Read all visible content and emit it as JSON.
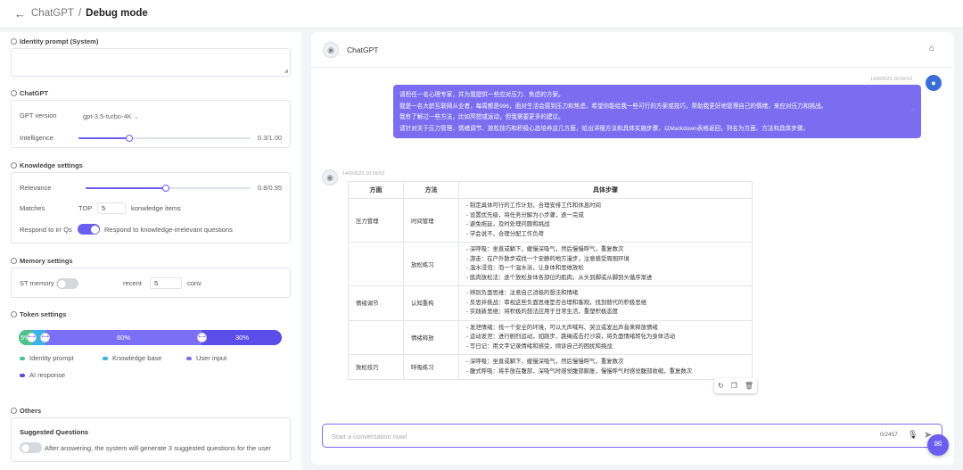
{
  "breadcrumb": {
    "back_icon": "arrow-left-icon",
    "parent": "ChatGPT",
    "separator": "/",
    "current": "Debug mode"
  },
  "identity": {
    "title": "Identity prompt (System)",
    "value": ""
  },
  "chatgpt_settings": {
    "title": "ChatGPT",
    "version_label": "GPT version",
    "version_value": "gpt-3.5-turbo-4K",
    "intelligence_label": "Intelligence",
    "intelligence_value": "0.3/1.00",
    "intelligence_level": 0.3
  },
  "knowledge": {
    "title": "Knowledge settings",
    "relevance_label": "Relevance",
    "relevance_value": "0.8/0.95",
    "relevance_level": 0.8,
    "matches_label": "Matches",
    "matches_top": "TOP",
    "matches_value": "5",
    "matches_suffix": "konwledge items",
    "respond_label": "Respond to irr Qs",
    "respond_on": true,
    "respond_desc": "Respond to knowledge-irrelevant questions"
  },
  "memory": {
    "title": "Memory settings",
    "st_label": "ST memory",
    "st_on": false,
    "recent_label": "recent",
    "recent_value": "5",
    "conv_label": "conv"
  },
  "token": {
    "title": "Token settings",
    "seg1": "5%",
    "seg3": "60%",
    "seg4": "30%",
    "legend": [
      {
        "label": "Identity prompt",
        "color": "#4cc38a"
      },
      {
        "label": "Knowledge base",
        "color": "#3ab3e8"
      },
      {
        "label": "User input",
        "color": "#7b70f5"
      },
      {
        "label": "AI response",
        "color": "#5b4ee8"
      }
    ]
  },
  "others": {
    "title": "Others",
    "suggested_title": "Suggested Questions",
    "suggested_on": false,
    "suggested_desc": "After answering, the system will generate 3 suggested questions for the user"
  },
  "chat": {
    "title": "ChatGPT",
    "user_time": "14/9/2023 20:59:52",
    "user_lines": [
      "请担任一名心理专家，并为我提供一些应对压力、焦虑的方案。",
      "我是一名大龄互联网从业者，每周都是996，面对生活会感到压力和焦虑，希望你能给我一些可行的方案或技巧，帮助我更好地管理自己的情绪，来应对压力和挑战。",
      "我有了解过一些方法，比如冥想或运动，但我需要更多的建议。",
      "请针对关于压力管理、情绪调节、放松技巧和积极心态培养这几方面，给出详细方法和具体实施步骤，以Markdown表格返回，列名为方面、方法和具体步骤。"
    ],
    "bot_time": "14/9/2023 20:59:52",
    "table_headers": [
      "方面",
      "方法",
      "具体步骤"
    ],
    "table_rows": [
      {
        "aspect": "压力管理",
        "method": "时间管理",
        "steps": [
          "- 制定具体可行的工作计划，合理安排工作和休息时间",
          "- 设置优先级，将任务分解为小步骤，逐一完成",
          "- 避免拖延，及时处理问题和挑战",
          "- 学会说不，合理分配工作负荷"
        ]
      },
      {
        "aspect": "",
        "method": "放松练习",
        "steps": [
          "- 深呼吸：坐直或躺下，缓慢深吸气，然后慢慢呼气，重复数次",
          "- 游走：在户外散步或找一个安静的地方漫步，注意感受周围环境",
          "- 温水浸泡：泡一个温水浴，让身体和思维放松",
          "- 肌肉放松法：逐个放松身体各部位的肌肉，从头到脚或从脚到头循序渐进"
        ]
      },
      {
        "aspect": "情绪调节",
        "method": "认知重构",
        "steps": [
          "- 辨别负面思维：注意自己消极的想法和情绪",
          "- 反思并挑战：审视这些负面思维是否合理和客观，找到替代的积极思维",
          "- 实践新思维：将积极的想法应用于日常生活，重塑积极态度"
        ]
      },
      {
        "aspect": "",
        "method": "情绪释放",
        "steps": [
          "- 发泄情绪：找一个安全的环境，可以大声喊叫、哭泣或发出声音来释放情绪",
          "- 运动发泄：进行剧烈运动，如跑步、跳绳或击打沙袋，将负面情绪转化为身体活动",
          "- 写日记：用文字记录情绪和感受，倾诉自己的困扰和挑战"
        ]
      },
      {
        "aspect": "放松技巧",
        "method": "呼吸练习",
        "steps": [
          "- 深呼吸：坐直或躺下，缓慢深吸气，然后慢慢呼气，重复数次",
          "- 腹式呼吸：将手放在腹部，深吸气时感觉腹部膨胀，慢慢呼气时感觉腹部收缩，重复数次"
        ]
      }
    ],
    "input_placeholder": "Start a conversation now!",
    "counter": "0/2457"
  }
}
